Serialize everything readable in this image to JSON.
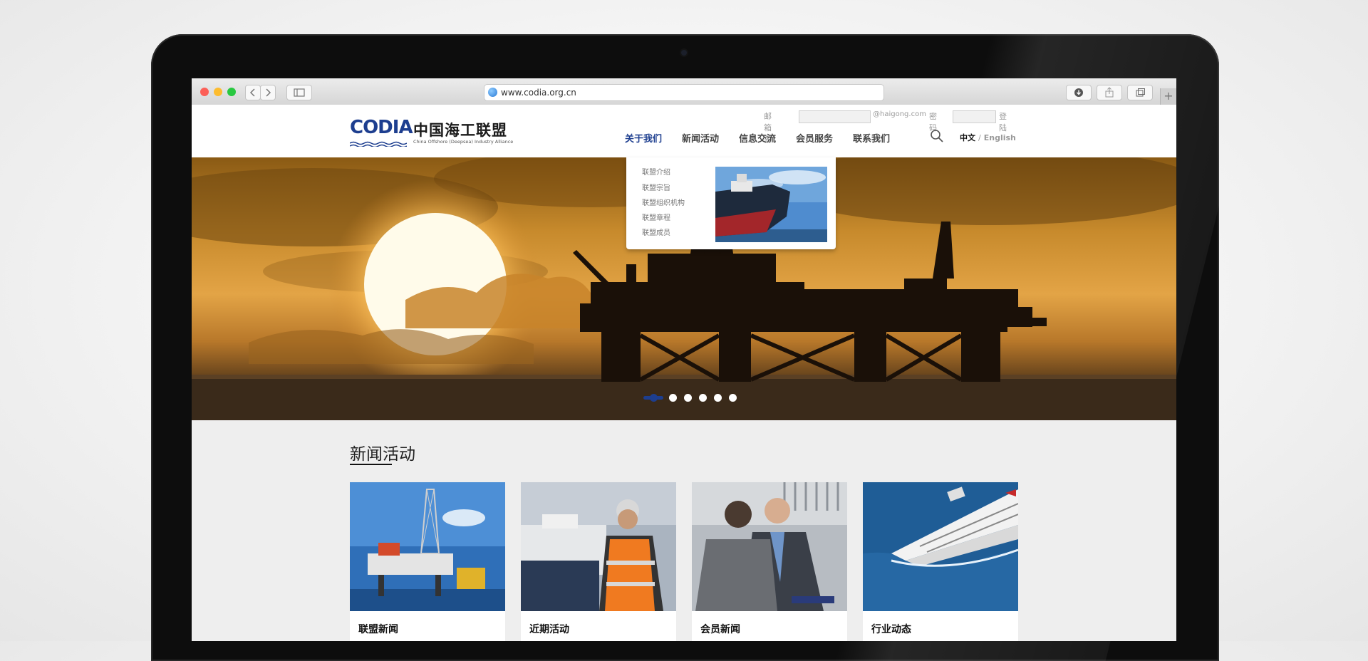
{
  "browser": {
    "url": "www.codia.org.cn",
    "back_icon": "chevron-left-icon",
    "forward_icon": "chevron-right-icon",
    "sidebar_icon": "sidebar-icon",
    "download_icon": "download-icon",
    "share_icon": "share-icon",
    "tabs_icon": "tabs-icon",
    "new_tab_label": "+"
  },
  "site": {
    "logo_mark": "CODIA",
    "logo_name_cn": "中国海工联盟",
    "logo_name_en": "China Offshore (Deepsea) Industry Alliance",
    "login": {
      "email_label": "邮箱名",
      "email_domain": "@haigong.com",
      "password_label": "密码",
      "submit_label": "登陆"
    },
    "nav": [
      {
        "label": "关于我们",
        "active": true
      },
      {
        "label": "新闻活动",
        "active": false
      },
      {
        "label": "信息交流",
        "active": false
      },
      {
        "label": "会员服务",
        "active": false
      },
      {
        "label": "联系我们",
        "active": false
      }
    ],
    "lang": {
      "zh": "中文",
      "sep": "/",
      "en": "English"
    },
    "dropdown": [
      "联盟介绍",
      "联盟宗旨",
      "联盟组织机构",
      "联盟章程",
      "联盟成员"
    ],
    "carousel": {
      "count": 6,
      "active_index": 0
    },
    "news": {
      "title": "新闻活动",
      "cards": [
        {
          "label": "联盟新闻"
        },
        {
          "label": "近期活动"
        },
        {
          "label": "会员新闻"
        },
        {
          "label": "行业动态"
        }
      ]
    }
  },
  "colors": {
    "brand_blue": "#1d3e8f",
    "brand_red": "#d22c2c",
    "bezel": "#0d0d0d"
  }
}
